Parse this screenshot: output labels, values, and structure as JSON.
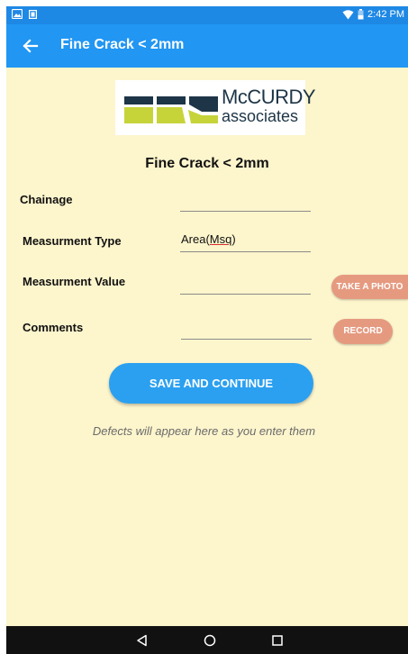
{
  "colors": {
    "status_bar": "#1e88e5",
    "app_bar": "#2196f3",
    "page_background": "#fdf5cc",
    "primary_button": "#2ba0f0",
    "secondary_button": "#e59a80",
    "nav_bar": "#111111",
    "logo_navy": "#1d3547",
    "logo_green": "#c6d43a"
  },
  "status_bar": {
    "icons": [
      "gallery-icon",
      "notification-square-icon",
      "wifi-icon",
      "battery-icon"
    ],
    "time": "2:42 PM"
  },
  "app_bar": {
    "back_icon": "arrow-left-icon",
    "title": "Fine Crack < 2mm"
  },
  "logo": {
    "line1": "McCURDY",
    "line2": "associates"
  },
  "page": {
    "heading": "Fine Crack < 2mm"
  },
  "form": {
    "chainage": {
      "label": "Chainage",
      "value": "",
      "placeholder": ""
    },
    "measurement_type": {
      "label": "Measurment Type",
      "value_prefix": "Area(",
      "value_unit": "Msq",
      "value_suffix": ")"
    },
    "measurement_value": {
      "label": "Measurment Value",
      "value": "",
      "placeholder": ""
    },
    "comments": {
      "label": "Comments",
      "value": "",
      "placeholder": ""
    },
    "take_photo_label": "TAKE A PHOTO",
    "record_label": "RECORD",
    "save_label": "SAVE AND CONTINUE"
  },
  "hint": "Defects will appear here as you enter them",
  "nav_bar": {
    "icons": [
      "back-triangle-icon",
      "home-circle-icon",
      "recents-square-icon"
    ]
  }
}
